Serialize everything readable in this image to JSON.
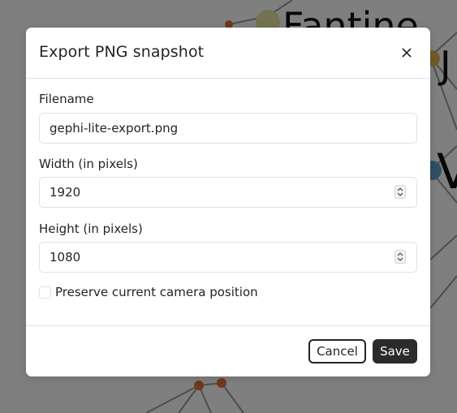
{
  "background": {
    "node_labels": [
      "Fantine",
      "J",
      "V"
    ]
  },
  "dialog": {
    "title": "Export PNG snapshot",
    "close_icon": "close-icon",
    "filename": {
      "label": "Filename",
      "value": "gephi-lite-export.png"
    },
    "width": {
      "label": "Width (in pixels)",
      "value": "1920"
    },
    "height": {
      "label": "Height (in pixels)",
      "value": "1080"
    },
    "preserve_camera": {
      "label": "Preserve current camera position",
      "checked": false
    },
    "cancel_label": "Cancel",
    "save_label": "Save"
  },
  "colors": {
    "overlay": "#808080",
    "node_orange": "#e0713a",
    "node_yellow": "#e8e6a0",
    "node_gold": "#e6b34f",
    "node_blue": "#5aa0c8",
    "edge": "#9a9a9a",
    "button_dark": "#2b2b2b"
  }
}
